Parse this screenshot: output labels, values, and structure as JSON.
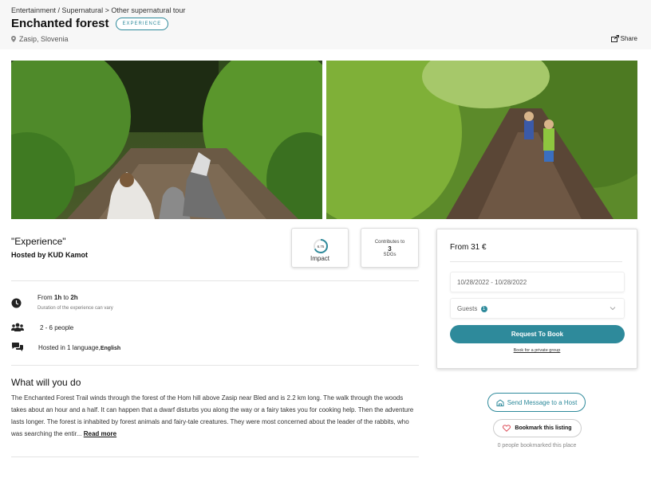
{
  "header": {
    "breadcrumb": "Entertainment / Supernatural > Other supernatural tour",
    "title": "Enchanted forest",
    "badge": "EXPERIENCE",
    "location": "Zasip, Slovenia",
    "share_label": "Share"
  },
  "listing": {
    "type_title": "\"Experience\"",
    "hosted_by": "Hosted by KUD Kamot",
    "impact": {
      "score": "6.75",
      "label": "Impact",
      "fraction": 0.675
    },
    "sdg": {
      "top": "Contributes to",
      "count": "3",
      "bottom": "SDGs"
    }
  },
  "details": {
    "duration_pre": "From ",
    "duration_min": "1h",
    "duration_mid": " to ",
    "duration_max": "2h",
    "duration_note": "Duration of the experience can vary",
    "people": "2 - 6 people",
    "language_pre": "Hosted in 1 language,",
    "language": "English"
  },
  "description": {
    "heading": "What will you do",
    "text": "The Enchanted Forest Trail winds through the forest of the Hom hill above Zasip near Bled and is 2.2 km long. The walk through the woods takes about an hour and a half. It can happen that a dwarf disturbs you along the way or a fairy takes you for cooking help. Then the adventure lasts longer. The forest is inhabited by forest animals and fairy-tale creatures. They were most concerned about the leader of the rabbits, who was searching the entir...",
    "read_more": "Read more"
  },
  "booking": {
    "from": "From 31 €",
    "dates": "10/28/2022 - 10/28/2022",
    "guests_label": "Guests",
    "guests_count": "1",
    "request_label": "Request To Book",
    "private_label": "Book for a private group"
  },
  "actions": {
    "message_label": "Send Message to a Host",
    "bookmark_label": "Bookmark this listing",
    "bookmark_count": "0 people bookmarked this place"
  },
  "colors": {
    "accent": "#2e8a9b",
    "impact_ring": "#2e8a9b"
  }
}
